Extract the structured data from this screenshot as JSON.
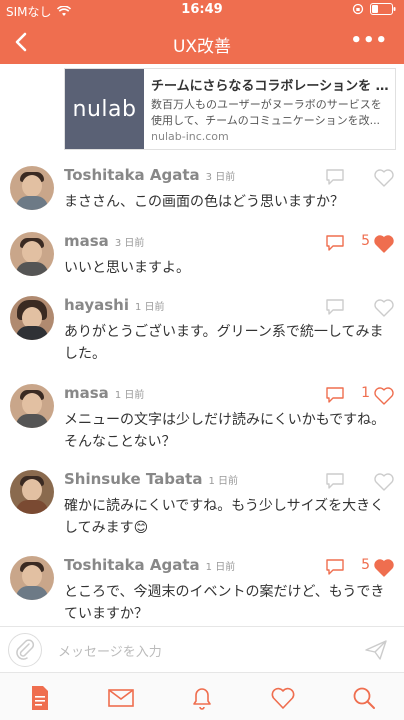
{
  "status": {
    "carrier": "SIMなし",
    "time": "16:49"
  },
  "nav": {
    "title": "UX改善",
    "more": "•••"
  },
  "preview": {
    "thumb_text": "nulab",
    "title": "チームにさらなるコラボレーションを |...",
    "description": "数百万人ものユーザーがヌーラボのサービスを使用して、チームのコミュニケーションを改...",
    "url": "nulab-inc.com"
  },
  "messages": [
    {
      "name": "Toshitaka Agata",
      "time": "3 日前",
      "text": "まささん、この画面の色はどう思いますか？",
      "likes": "",
      "liked": false,
      "commented": false
    },
    {
      "name": "masa",
      "time": "3 日前",
      "text": "いいと思いますよ。",
      "likes": "5",
      "liked": true,
      "commented": true
    },
    {
      "name": "hayashi",
      "time": "1 日前",
      "text": "ありがとうございます。グリーン系で統一してみました。",
      "likes": "",
      "liked": false,
      "commented": false
    },
    {
      "name": "masa",
      "time": "1 日前",
      "text": "メニューの文字は少しだけ読みにくいかもですね。そんなことない？",
      "likes": "1",
      "liked": false,
      "commented": true
    },
    {
      "name": "Shinsuke Tabata",
      "time": "1 日前",
      "text": "確かに読みにくいですね。もう少しサイズを大きくしてみます😊",
      "likes": "",
      "liked": false,
      "commented": false
    },
    {
      "name": "Toshitaka Agata",
      "time": "1 日前",
      "text": "ところで、今週末のイベントの案だけど、もうできていますか？",
      "likes": "5",
      "liked": true,
      "commented": true
    }
  ],
  "input": {
    "placeholder": "メッセージを入力"
  },
  "tabs": [
    "document-icon",
    "mail-icon",
    "bell-icon",
    "heart-icon",
    "search-icon"
  ],
  "colors": {
    "accent": "#ef6e4f",
    "inactive": "#cccccc"
  }
}
